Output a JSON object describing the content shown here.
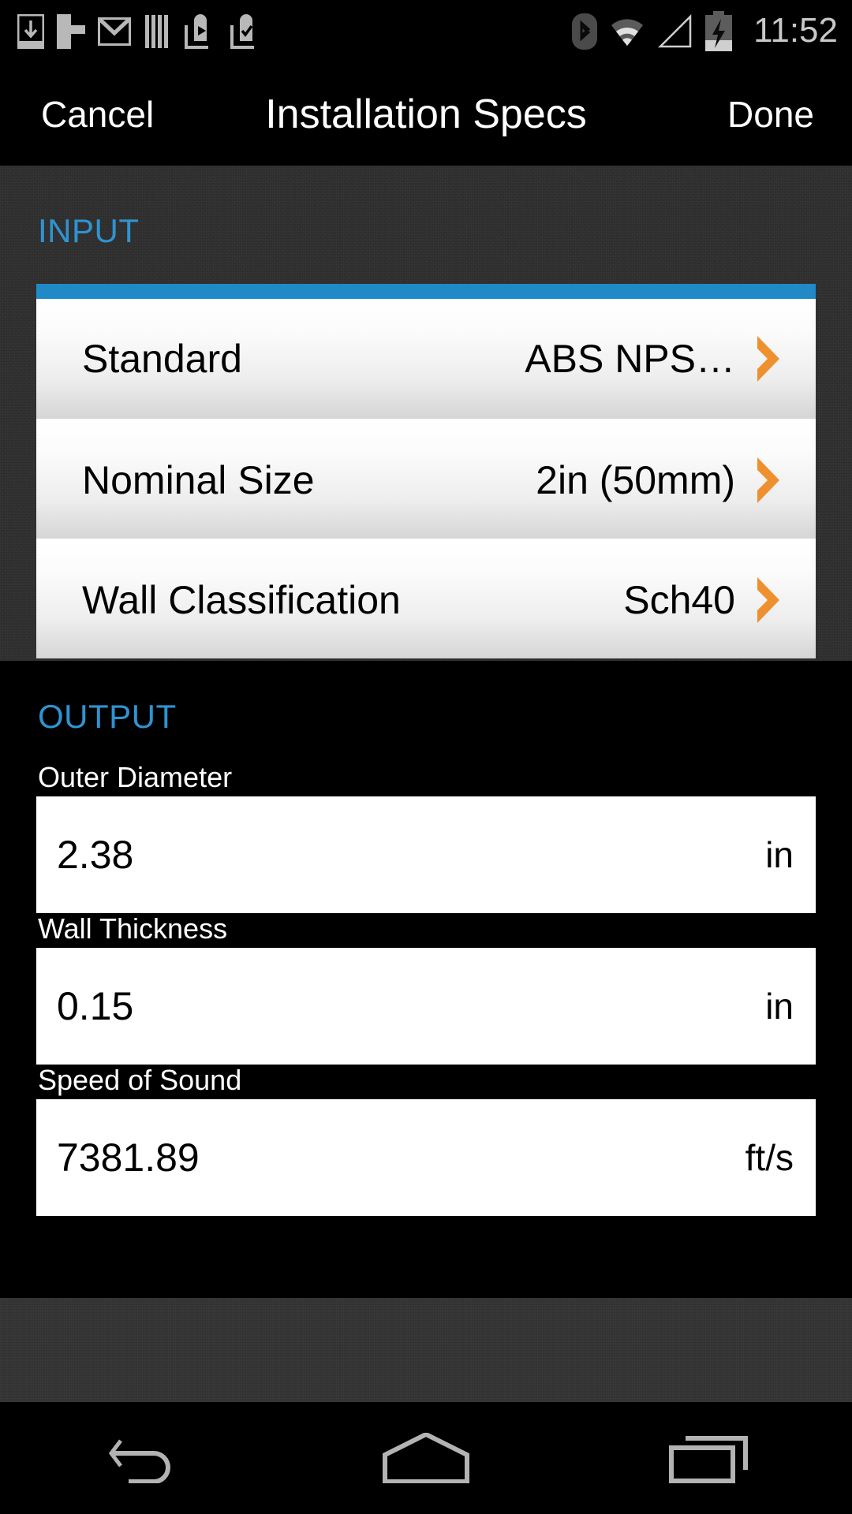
{
  "statusbar": {
    "time": "11:52",
    "left_icons": [
      {
        "name": "download-manager-icon"
      },
      {
        "name": "flipboard-icon"
      },
      {
        "name": "gmail-icon"
      },
      {
        "name": "library-icon"
      },
      {
        "name": "play-store-update-icon"
      },
      {
        "name": "app-installed-icon"
      }
    ],
    "right_icons": [
      {
        "name": "bluetooth-icon"
      },
      {
        "name": "wifi-icon"
      },
      {
        "name": "cellular-signal-icon"
      },
      {
        "name": "battery-charging-icon"
      }
    ]
  },
  "titlebar": {
    "cancel_label": "Cancel",
    "title": "Installation Specs",
    "done_label": "Done"
  },
  "input": {
    "section_title": "INPUT",
    "rows": [
      {
        "label": "Standard",
        "value": "ABS NPS…"
      },
      {
        "label": "Nominal Size",
        "value": "2in (50mm)"
      },
      {
        "label": "Wall Classification",
        "value": "Sch40"
      }
    ]
  },
  "output": {
    "section_title": "OUTPUT",
    "fields": [
      {
        "label": "Outer Diameter",
        "value": "2.38",
        "unit": "in"
      },
      {
        "label": "Wall Thickness",
        "value": "0.15",
        "unit": "in"
      },
      {
        "label": "Speed of Sound",
        "value": "7381.89",
        "unit": "ft/s"
      }
    ]
  },
  "navbar": {
    "back_label": "Back",
    "home_label": "Home",
    "recents_label": "Recent apps"
  },
  "colors": {
    "accent_blue": "#2089c6",
    "section_heading_blue": "#2f93d1",
    "chevron_orange": "#ef9030",
    "background_dark": "#2e2e2e",
    "background_black": "#000000"
  }
}
